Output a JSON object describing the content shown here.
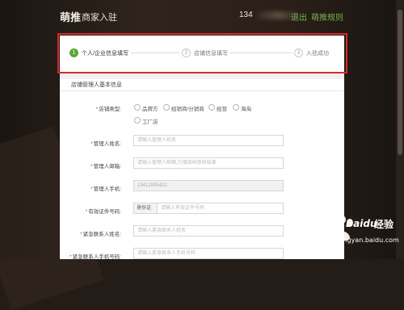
{
  "header": {
    "logo_brand": "萌推",
    "logo_sub": "商家入驻",
    "phone": "134",
    "quit_label": "退出",
    "rules_label": "萌推规则"
  },
  "steps": [
    {
      "number": "1",
      "label": "个人/企业信息填写"
    },
    {
      "number": "2",
      "label": "店铺信息填写"
    },
    {
      "number": "3",
      "label": "入驻成功"
    }
  ],
  "section": {
    "title": "店铺管理人基本信息"
  },
  "form": {
    "store_type": {
      "label": "店铺类型:",
      "options": [
        "品牌方",
        "经销商/分销商",
        "经营",
        "海淘",
        "工厂店"
      ]
    },
    "manager_name": {
      "label": "管理人姓名:",
      "placeholder": "请输入管理人姓名"
    },
    "manager_email": {
      "label": "管理人邮箱:",
      "placeholder": "请输入管理人邮箱,方便接收审核结果"
    },
    "manager_phone": {
      "label": "管理人手机:",
      "value": "13412005422"
    },
    "id_number": {
      "label": "有效证件号码:",
      "type_value": "身份证",
      "placeholder": "请输入有效证件号码"
    },
    "emergency_name": {
      "label": "紧急联系人姓名:",
      "placeholder": "请输入紧急联系人姓名"
    },
    "emergency_phone": {
      "label": "紧急联系人手机号码:",
      "placeholder": "请输入紧急联系人手机号码"
    }
  },
  "watermark": {
    "brand": "Baidu",
    "cn": "经验",
    "url": "jingyan.baidu.com"
  },
  "colors": {
    "accent_green": "#5aa838",
    "link_green": "#76b34b",
    "required_red": "#e23c3c",
    "highlight_frame": "#d82a2a"
  }
}
